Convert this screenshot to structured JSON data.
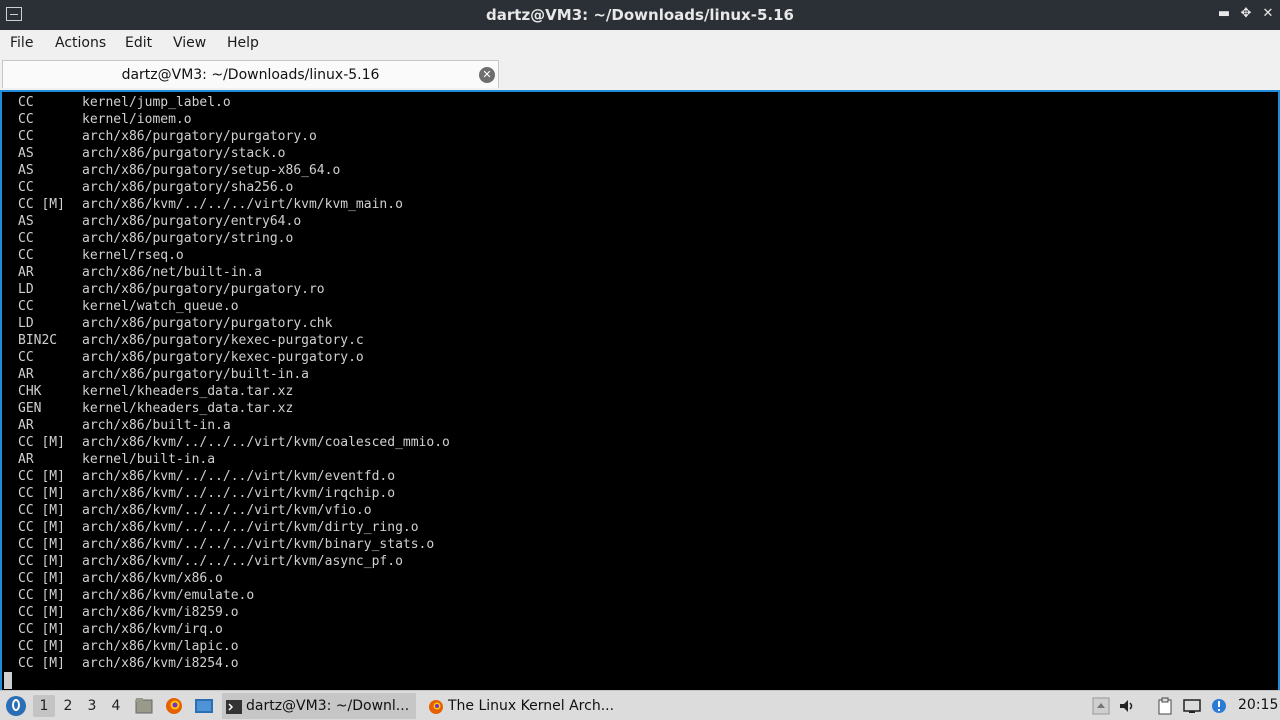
{
  "window": {
    "title": "dartz@VM3: ~/Downloads/linux-5.16",
    "minimize_glyph": "▬",
    "maximize_glyph": "✥",
    "close_glyph": "✕"
  },
  "menu": [
    "File",
    "Actions",
    "Edit",
    "View",
    "Help"
  ],
  "tab": {
    "label": "dartz@VM3: ~/Downloads/linux-5.16",
    "close_glyph": "✕"
  },
  "terminal": {
    "lines": [
      {
        "tag": "CC",
        "path": "kernel/jump_label.o"
      },
      {
        "tag": "CC",
        "path": "kernel/iomem.o"
      },
      {
        "tag": "CC",
        "path": "arch/x86/purgatory/purgatory.o"
      },
      {
        "tag": "AS",
        "path": "arch/x86/purgatory/stack.o"
      },
      {
        "tag": "AS",
        "path": "arch/x86/purgatory/setup-x86_64.o"
      },
      {
        "tag": "CC",
        "path": "arch/x86/purgatory/sha256.o"
      },
      {
        "tag": "CC [M]",
        "path": "arch/x86/kvm/../../../virt/kvm/kvm_main.o"
      },
      {
        "tag": "AS",
        "path": "arch/x86/purgatory/entry64.o"
      },
      {
        "tag": "CC",
        "path": "arch/x86/purgatory/string.o"
      },
      {
        "tag": "CC",
        "path": "kernel/rseq.o"
      },
      {
        "tag": "AR",
        "path": "arch/x86/net/built-in.a"
      },
      {
        "tag": "LD",
        "path": "arch/x86/purgatory/purgatory.ro"
      },
      {
        "tag": "CC",
        "path": "kernel/watch_queue.o"
      },
      {
        "tag": "LD",
        "path": "arch/x86/purgatory/purgatory.chk"
      },
      {
        "tag": "BIN2C",
        "path": "arch/x86/purgatory/kexec-purgatory.c"
      },
      {
        "tag": "CC",
        "path": "arch/x86/purgatory/kexec-purgatory.o"
      },
      {
        "tag": "AR",
        "path": "arch/x86/purgatory/built-in.a"
      },
      {
        "tag": "CHK",
        "path": "kernel/kheaders_data.tar.xz"
      },
      {
        "tag": "GEN",
        "path": "kernel/kheaders_data.tar.xz"
      },
      {
        "tag": "AR",
        "path": "arch/x86/built-in.a"
      },
      {
        "tag": "CC [M]",
        "path": "arch/x86/kvm/../../../virt/kvm/coalesced_mmio.o"
      },
      {
        "tag": "AR",
        "path": "kernel/built-in.a"
      },
      {
        "tag": "CC [M]",
        "path": "arch/x86/kvm/../../../virt/kvm/eventfd.o"
      },
      {
        "tag": "CC [M]",
        "path": "arch/x86/kvm/../../../virt/kvm/irqchip.o"
      },
      {
        "tag": "CC [M]",
        "path": "arch/x86/kvm/../../../virt/kvm/vfio.o"
      },
      {
        "tag": "CC [M]",
        "path": "arch/x86/kvm/../../../virt/kvm/dirty_ring.o"
      },
      {
        "tag": "CC [M]",
        "path": "arch/x86/kvm/../../../virt/kvm/binary_stats.o"
      },
      {
        "tag": "CC [M]",
        "path": "arch/x86/kvm/../../../virt/kvm/async_pf.o"
      },
      {
        "tag": "CC [M]",
        "path": "arch/x86/kvm/x86.o"
      },
      {
        "tag": "CC [M]",
        "path": "arch/x86/kvm/emulate.o"
      },
      {
        "tag": "CC [M]",
        "path": "arch/x86/kvm/i8259.o"
      },
      {
        "tag": "CC [M]",
        "path": "arch/x86/kvm/irq.o"
      },
      {
        "tag": "CC [M]",
        "path": "arch/x86/kvm/lapic.o"
      },
      {
        "tag": "CC [M]",
        "path": "arch/x86/kvm/i8254.o"
      }
    ]
  },
  "taskbar": {
    "workspaces": [
      "1",
      "2",
      "3",
      "4"
    ],
    "active_workspace": "1",
    "quicklaunch": [
      "file-manager-icon",
      "firefox-icon",
      "desktop-icon"
    ],
    "tasks": [
      {
        "label": "dartz@VM3: ~/Downl...",
        "icon": "terminal-icon",
        "active": true
      },
      {
        "label": "The Linux Kernel Arch...",
        "icon": "firefox-icon",
        "active": false
      }
    ],
    "tray": [
      "task-manager-icon",
      "volume-icon",
      "clipboard-icon",
      "network-icon",
      "update-notifier-icon"
    ],
    "clock": "20:15"
  },
  "colors": {
    "titlebar": "#2b3036",
    "terminal_bg": "#000000",
    "terminal_fg": "#d0d0d0",
    "focus_border": "#1e8cd6",
    "taskbar": "#dcdcdc",
    "start_button": "#2a6fb5"
  }
}
